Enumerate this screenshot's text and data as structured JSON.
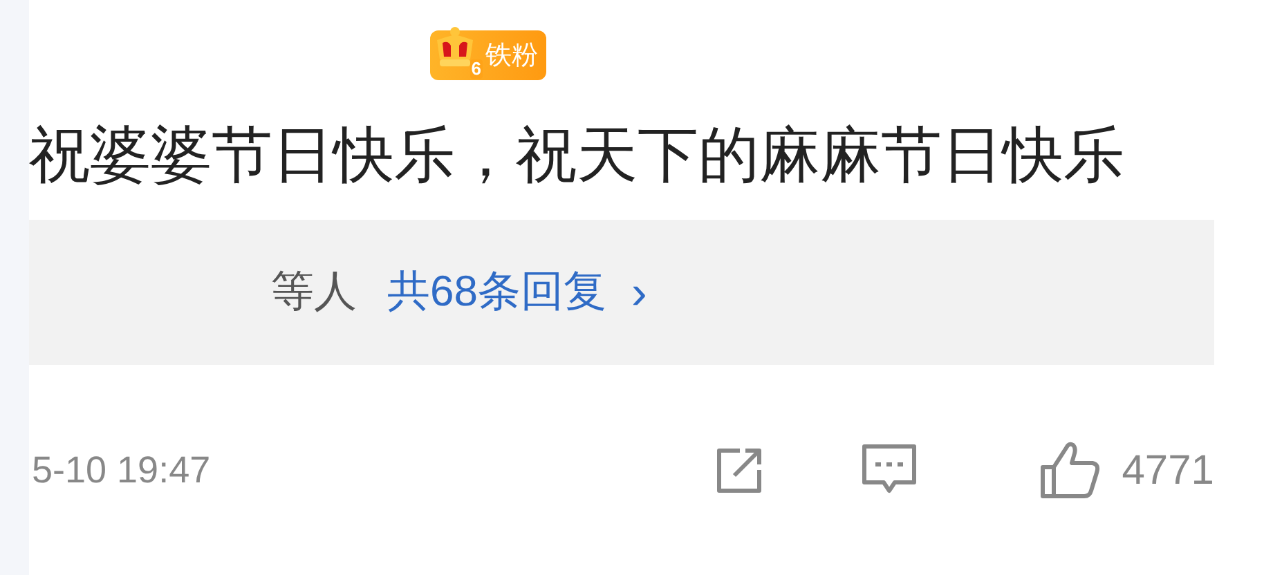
{
  "badge": {
    "level": "6",
    "label": "铁粉"
  },
  "comment": {
    "text": "祝婆婆节日快乐，祝天下的麻麻节日快乐"
  },
  "replies": {
    "prefix": "等人",
    "link": "共68条回复",
    "chevron": "›"
  },
  "footer": {
    "time": "5-10 19:47",
    "likes": "4771"
  }
}
